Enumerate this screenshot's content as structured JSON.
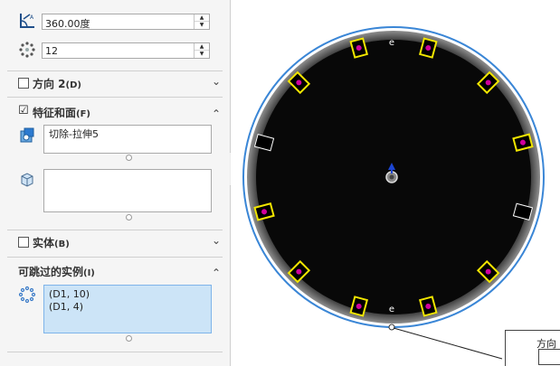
{
  "angle": {
    "value": "360.00度"
  },
  "count": {
    "value": "12"
  },
  "direction2": {
    "label": "方向 2",
    "hotkey": "(D)",
    "checked": ""
  },
  "features": {
    "label": "特征和面",
    "hotkey": "(F)",
    "checked": "☑",
    "feature_item": "切除-拉伸5"
  },
  "bodies": {
    "label": "实体",
    "hotkey": "(B)",
    "checked": ""
  },
  "skip": {
    "label": "可跳过的实例",
    "hotkey": "(I)",
    "items": [
      "(D1, 10)",
      "(D1, 4)"
    ]
  },
  "chevrons": {
    "down": "⌄",
    "up": "⌃"
  },
  "drawing": {
    "disk_color": "#080808",
    "rim_color": "#3a86d6",
    "slot_color": "#f2e600",
    "marker_color": "#d0009c",
    "total_instances": 12,
    "skipped_instances": [
      4,
      10
    ]
  },
  "table_stub": {
    "label": "方向"
  },
  "icons": {
    "angle": "angle-icon",
    "count": "pattern-count-icon",
    "features": "feature-icon",
    "faces": "face-icon",
    "skip": "skip-instances-icon"
  }
}
